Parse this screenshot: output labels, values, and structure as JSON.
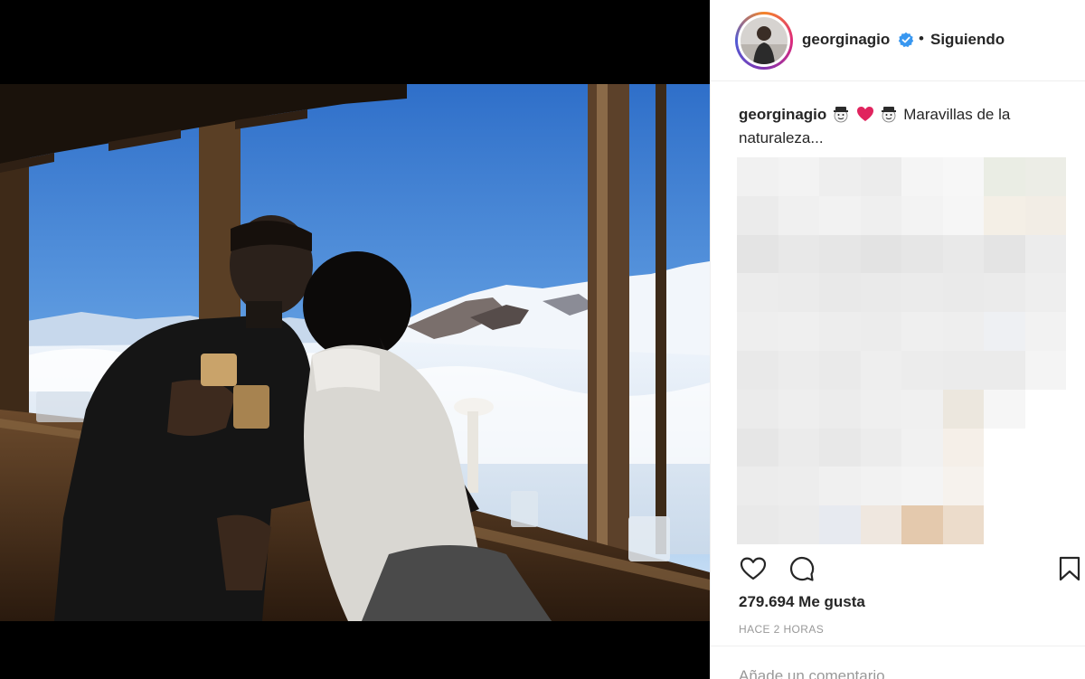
{
  "post": {
    "username": "georginagio",
    "follow_status": "Siguiendo",
    "separator": "•",
    "caption_user": "georginagio",
    "caption_text": "Maravillas de la naturaleza...",
    "likes": "279.694 Me gusta",
    "time_ago": "HACE 2 HORAS",
    "comment_placeholder": "Añade un comentario..."
  },
  "icons": {
    "verified": "verified-badge-icon",
    "like": "heart-icon",
    "comment": "comment-bubble-icon",
    "save": "bookmark-icon",
    "caption_emojis": [
      "snowman-icon",
      "red-heart-icon",
      "snowman-icon"
    ]
  },
  "colors": {
    "verified_blue": "#3897f0",
    "heart_red": "#ed4956",
    "text": "#262626",
    "muted": "#999999"
  }
}
